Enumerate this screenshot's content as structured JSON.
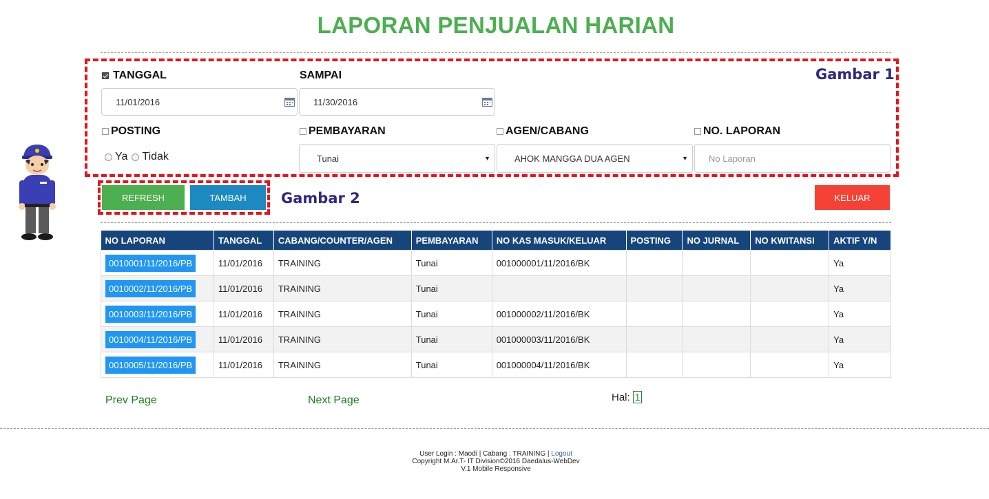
{
  "page": {
    "title": "LAPORAN PENJUALAN HARIAN"
  },
  "annotations": {
    "gambar1": "Gambar 1",
    "gambar2": "Gambar 2"
  },
  "filters": {
    "tanggal_label": "TANGGAL",
    "tanggal_checked": true,
    "tanggal_value": "11/01/2016",
    "sampai_label": "SAMPAI",
    "sampai_value": "11/30/2016",
    "posting_label": "POSTING",
    "posting_options": [
      "Ya",
      "Tidak"
    ],
    "pembayaran_label": "PEMBAYARAN",
    "pembayaran_value": "Tunai",
    "agen_label": "AGEN/CABANG",
    "agen_value": "AHOK MANGGA DUA AGEN",
    "nolaporan_label": "NO. LAPORAN",
    "nolaporan_placeholder": "No Laporan"
  },
  "buttons": {
    "refresh": "REFRESH",
    "tambah": "TAMBAH",
    "keluar": "KELUAR"
  },
  "table": {
    "headers": [
      "NO LAPORAN",
      "TANGGAL",
      "CABANG/COUNTER/AGEN",
      "PEMBAYARAN",
      "NO KAS MASUK/KELUAR",
      "POSTING",
      "NO JURNAL",
      "NO KWITANSI",
      "AKTIF Y/N"
    ],
    "rows": [
      [
        "0010001/11/2016/PB",
        "11/01/2016",
        "TRAINING",
        "Tunai",
        "001000001/11/2016/BK",
        "",
        "",
        "",
        "Ya"
      ],
      [
        "0010002/11/2016/PB",
        "11/01/2016",
        "TRAINING",
        "Tunai",
        "",
        "",
        "",
        "",
        "Ya"
      ],
      [
        "0010003/11/2016/PB",
        "11/01/2016",
        "TRAINING",
        "Tunai",
        "001000002/11/2016/BK",
        "",
        "",
        "",
        "Ya"
      ],
      [
        "0010004/11/2016/PB",
        "11/01/2016",
        "TRAINING",
        "Tunai",
        "001000003/11/2016/BK",
        "",
        "",
        "",
        "Ya"
      ],
      [
        "0010005/11/2016/PB",
        "11/01/2016",
        "TRAINING",
        "Tunai",
        "001000004/11/2016/BK",
        "",
        "",
        "",
        "Ya"
      ]
    ]
  },
  "pagination": {
    "prev": "Prev Page",
    "next": "Next Page",
    "hal_label": "Hal:",
    "current": "1"
  },
  "footer": {
    "line1_prefix": "User Login : Maodi | Cabang : TRAINING | ",
    "logout": "Logout",
    "line2": "Copyright M.Ar.T- IT Division©2016 Daedalus-WebDev",
    "line3": "V.1 Mobile Responsive"
  },
  "colors": {
    "title": "#4caf50",
    "header_bg": "#16457c",
    "badge": "#2196f3",
    "annotation": "#e8141b"
  }
}
